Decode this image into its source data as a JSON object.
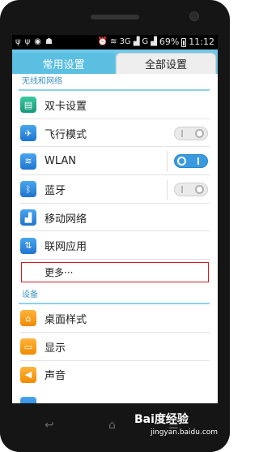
{
  "status_bar": {
    "battery_pct": "69%",
    "time": "11:12",
    "signal_label_1": "3G",
    "signal_label_2": "G"
  },
  "tabs": [
    {
      "label": "常用设置"
    },
    {
      "label": "全部设置"
    }
  ],
  "sections": [
    {
      "title": "无线和网络",
      "items": [
        {
          "label": "双卡设置",
          "icon": "dual-sim-icon"
        },
        {
          "label": "飞行模式",
          "icon": "airplane-icon",
          "toggle": "off"
        },
        {
          "label": "WLAN",
          "icon": "wifi-icon",
          "toggle": "on"
        },
        {
          "label": "蓝牙",
          "icon": "bluetooth-icon",
          "toggle": "off"
        },
        {
          "label": "移动网络",
          "icon": "signal-icon"
        },
        {
          "label": "联网应用",
          "icon": "data-apps-icon"
        }
      ],
      "more": "更多···"
    },
    {
      "title": "设备",
      "items": [
        {
          "label": "桌面样式",
          "icon": "home-style-icon"
        },
        {
          "label": "显示",
          "icon": "display-icon"
        },
        {
          "label": "声音",
          "icon": "sound-icon"
        }
      ]
    }
  ],
  "watermark": {
    "brand": "Bai度经验",
    "url": "jingyan.baidu.com"
  }
}
